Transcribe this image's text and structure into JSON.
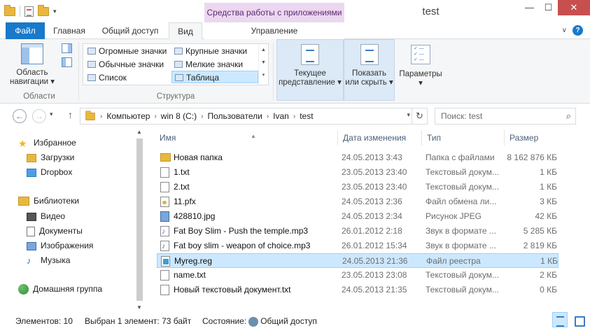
{
  "window": {
    "title": "test",
    "context_tab_label": "Средства работы с приложениями",
    "buttons": {
      "minimize": "—",
      "maximize": "☐",
      "close": "✕"
    }
  },
  "ribbon_tabs": {
    "file": "Файл",
    "home": "Главная",
    "share": "Общий доступ",
    "view": "Вид",
    "manage": "Управление"
  },
  "ribbon": {
    "panes_group": "Области",
    "nav_pane_button": "Область навигации",
    "layout_group": "Структура",
    "layout_items": [
      "Огромные значки",
      "Крупные значки",
      "Обычные значки",
      "Мелкие значки",
      "Список",
      "Таблица"
    ],
    "current_view": "Текущее представление",
    "show_hide": "Показать или скрыть",
    "options": "Параметры"
  },
  "address": {
    "crumbs": [
      "Компьютер",
      "win 8 (C:)",
      "Пользователи",
      "Ivan",
      "test"
    ],
    "search_placeholder": "Поиск: test"
  },
  "nav_pane": {
    "favorites": "Избранное",
    "downloads": "Загрузки",
    "dropbox": "Dropbox",
    "libraries": "Библиотеки",
    "video": "Видео",
    "documents": "Документы",
    "images": "Изображения",
    "music": "Музыка",
    "homegroup": "Домашняя группа"
  },
  "columns": {
    "name": "Имя",
    "date": "Дата изменения",
    "type": "Тип",
    "size": "Размер"
  },
  "files": [
    {
      "name": "Новая папка",
      "date": "24.05.2013 3:43",
      "type": "Папка с файлами",
      "size": "8 162 876 КБ",
      "icon": "folder"
    },
    {
      "name": "1.txt",
      "date": "23.05.2013 23:40",
      "type": "Текстовый докум...",
      "size": "1 КБ",
      "icon": "txt"
    },
    {
      "name": "2.txt",
      "date": "23.05.2013 23:40",
      "type": "Текстовый докум...",
      "size": "1 КБ",
      "icon": "txt"
    },
    {
      "name": "11.pfx",
      "date": "24.05.2013 2:36",
      "type": "Файл обмена ли...",
      "size": "3 КБ",
      "icon": "pfx"
    },
    {
      "name": "428810.jpg",
      "date": "24.05.2013 2:34",
      "type": "Рисунок JPEG",
      "size": "42 КБ",
      "icon": "jpg"
    },
    {
      "name": "Fat Boy Slim - Push the temple.mp3",
      "date": "26.01.2012 2:18",
      "type": "Звук в формате ...",
      "size": "5 285 КБ",
      "icon": "mp3"
    },
    {
      "name": "Fat boy slim - weapon of choice.mp3",
      "date": "26.01.2012 15:34",
      "type": "Звук в формате ...",
      "size": "2 819 КБ",
      "icon": "mp3"
    },
    {
      "name": "Myreg.reg",
      "date": "24.05.2013 21:36",
      "type": "Файл реестра",
      "size": "1 КБ",
      "icon": "reg",
      "selected": true
    },
    {
      "name": "name.txt",
      "date": "23.05.2013 23:08",
      "type": "Текстовый докум...",
      "size": "2 КБ",
      "icon": "txt"
    },
    {
      "name": "Новый текстовый документ.txt",
      "date": "24.05.2013 21:35",
      "type": "Текстовый докум...",
      "size": "0 КБ",
      "icon": "txt"
    }
  ],
  "status": {
    "items": "Элементов: 10",
    "selected": "Выбран 1 элемент: 73 байт",
    "state_label": "Состояние:",
    "state_value": "Общий доступ"
  }
}
